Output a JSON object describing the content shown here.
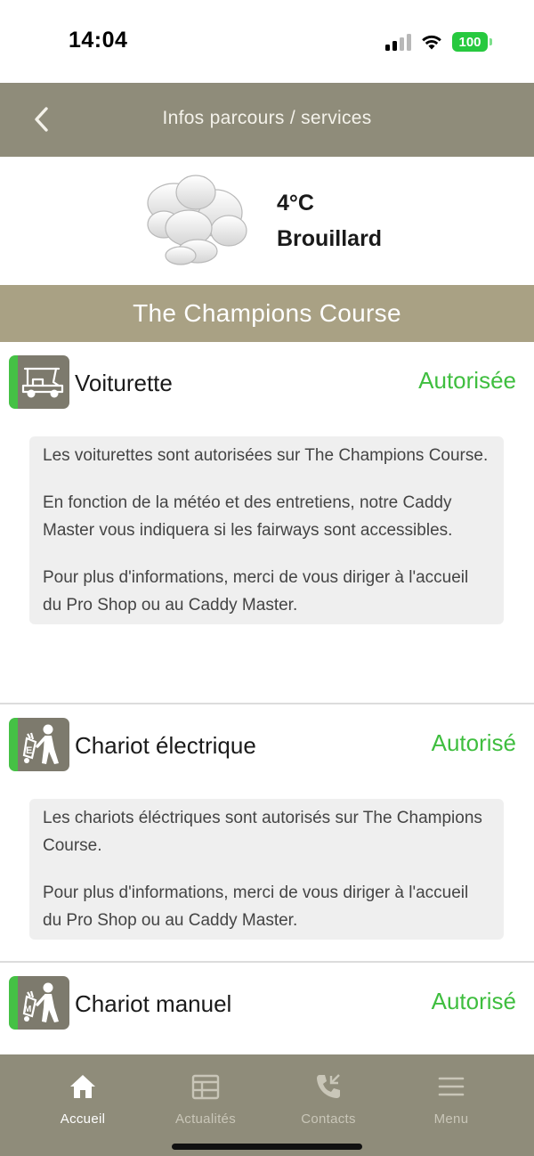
{
  "status_bar": {
    "time": "14:04",
    "battery": "100",
    "signal_icon": "cellular-signal-icon",
    "wifi_icon": "wifi-icon",
    "battery_color": "#27c93f"
  },
  "header": {
    "title": "Infos parcours / services",
    "back_icon": "chevron-left-icon",
    "bg_color": "#8f8c7a"
  },
  "weather": {
    "icon": "fog-clouds-icon",
    "temperature": "4°C",
    "condition": "Brouillard"
  },
  "course": {
    "name": "The Champions Course",
    "bg_color": "#a9a184"
  },
  "services": [
    {
      "icon": "golf-cart-icon",
      "name": "Voiturette",
      "status": "Autorisée",
      "description": [
        "Les voiturettes sont autorisées sur The Champions Course.",
        "En fonction de la météo et des entretiens, notre Caddy Master vous indiquera si les fairways sont accessibles.",
        "Pour plus d'informations, merci de vous diriger à l'accueil du Pro Shop ou au Caddy Master."
      ]
    },
    {
      "icon": "electric-trolley-icon",
      "name": "Chariot électrique",
      "status": "Autorisé",
      "description": [
        "Les chariots éléctriques sont autorisés sur The Champions Course.",
        "Pour plus d'informations, merci de vous diriger à l'accueil du Pro Shop ou au Caddy Master."
      ]
    },
    {
      "icon": "manual-trolley-icon",
      "name": "Chariot manuel",
      "status": "Autorisé"
    }
  ],
  "status_color": "#3fbe3f",
  "tab_bar": {
    "tabs": [
      {
        "label": "Accueil",
        "icon": "home-icon",
        "active": true
      },
      {
        "label": "Actualités",
        "icon": "newspaper-icon",
        "active": false
      },
      {
        "label": "Contacts",
        "icon": "phone-icon",
        "active": false
      },
      {
        "label": "Menu",
        "icon": "hamburger-menu-icon",
        "active": false
      }
    ]
  }
}
